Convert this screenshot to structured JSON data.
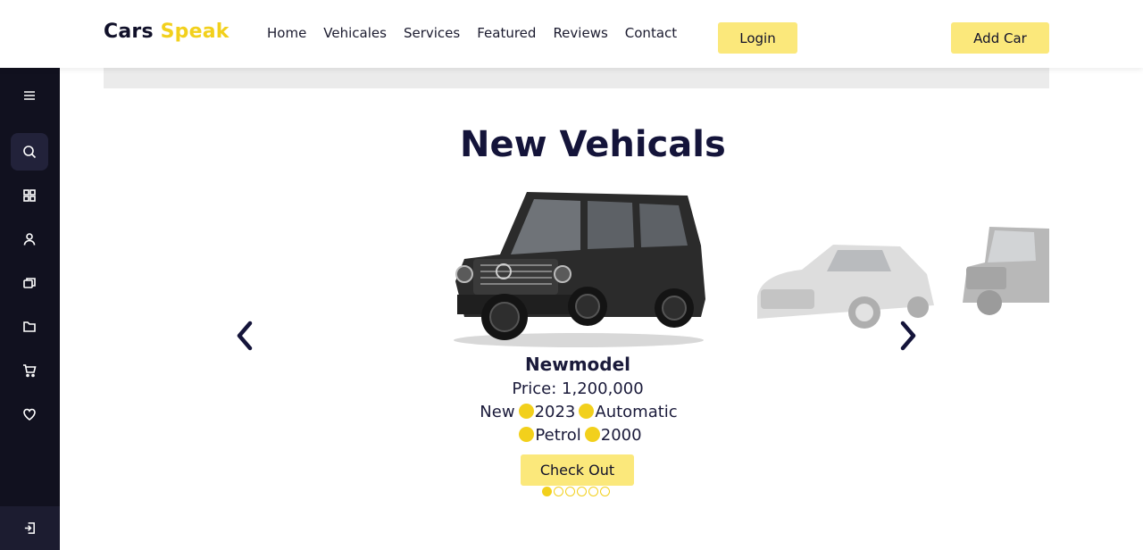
{
  "brand": {
    "part1": "Cars",
    "part2": "Speak"
  },
  "nav": {
    "items": [
      "Home",
      "Vehicales",
      "Services",
      "Featured",
      "Reviews",
      "Contact"
    ]
  },
  "header": {
    "login_label": "Login",
    "add_car_label": "Add Car"
  },
  "section": {
    "title_part1": "New",
    "title_part2": "Vehicals"
  },
  "car": {
    "model": "Newmodel",
    "price_label": "Price:",
    "price_value": "1,200,000",
    "specs_row1": [
      "New",
      "2023",
      "Automatic"
    ],
    "specs_row2": [
      "Petrol",
      "2000"
    ],
    "cta_label": "Check Out"
  },
  "carousel": {
    "slides": 6,
    "active_index": 0
  },
  "colors": {
    "accent": "#f2d01c",
    "button_bg": "#fbe87b",
    "sidebar_bg": "#11111f",
    "title": "#14143a"
  },
  "sidebar": {
    "icons": [
      "menu-icon",
      "search-icon",
      "grid-icon",
      "user-icon",
      "copy-icon",
      "folder-icon",
      "cart-icon",
      "heart-icon",
      "logout-icon"
    ]
  }
}
